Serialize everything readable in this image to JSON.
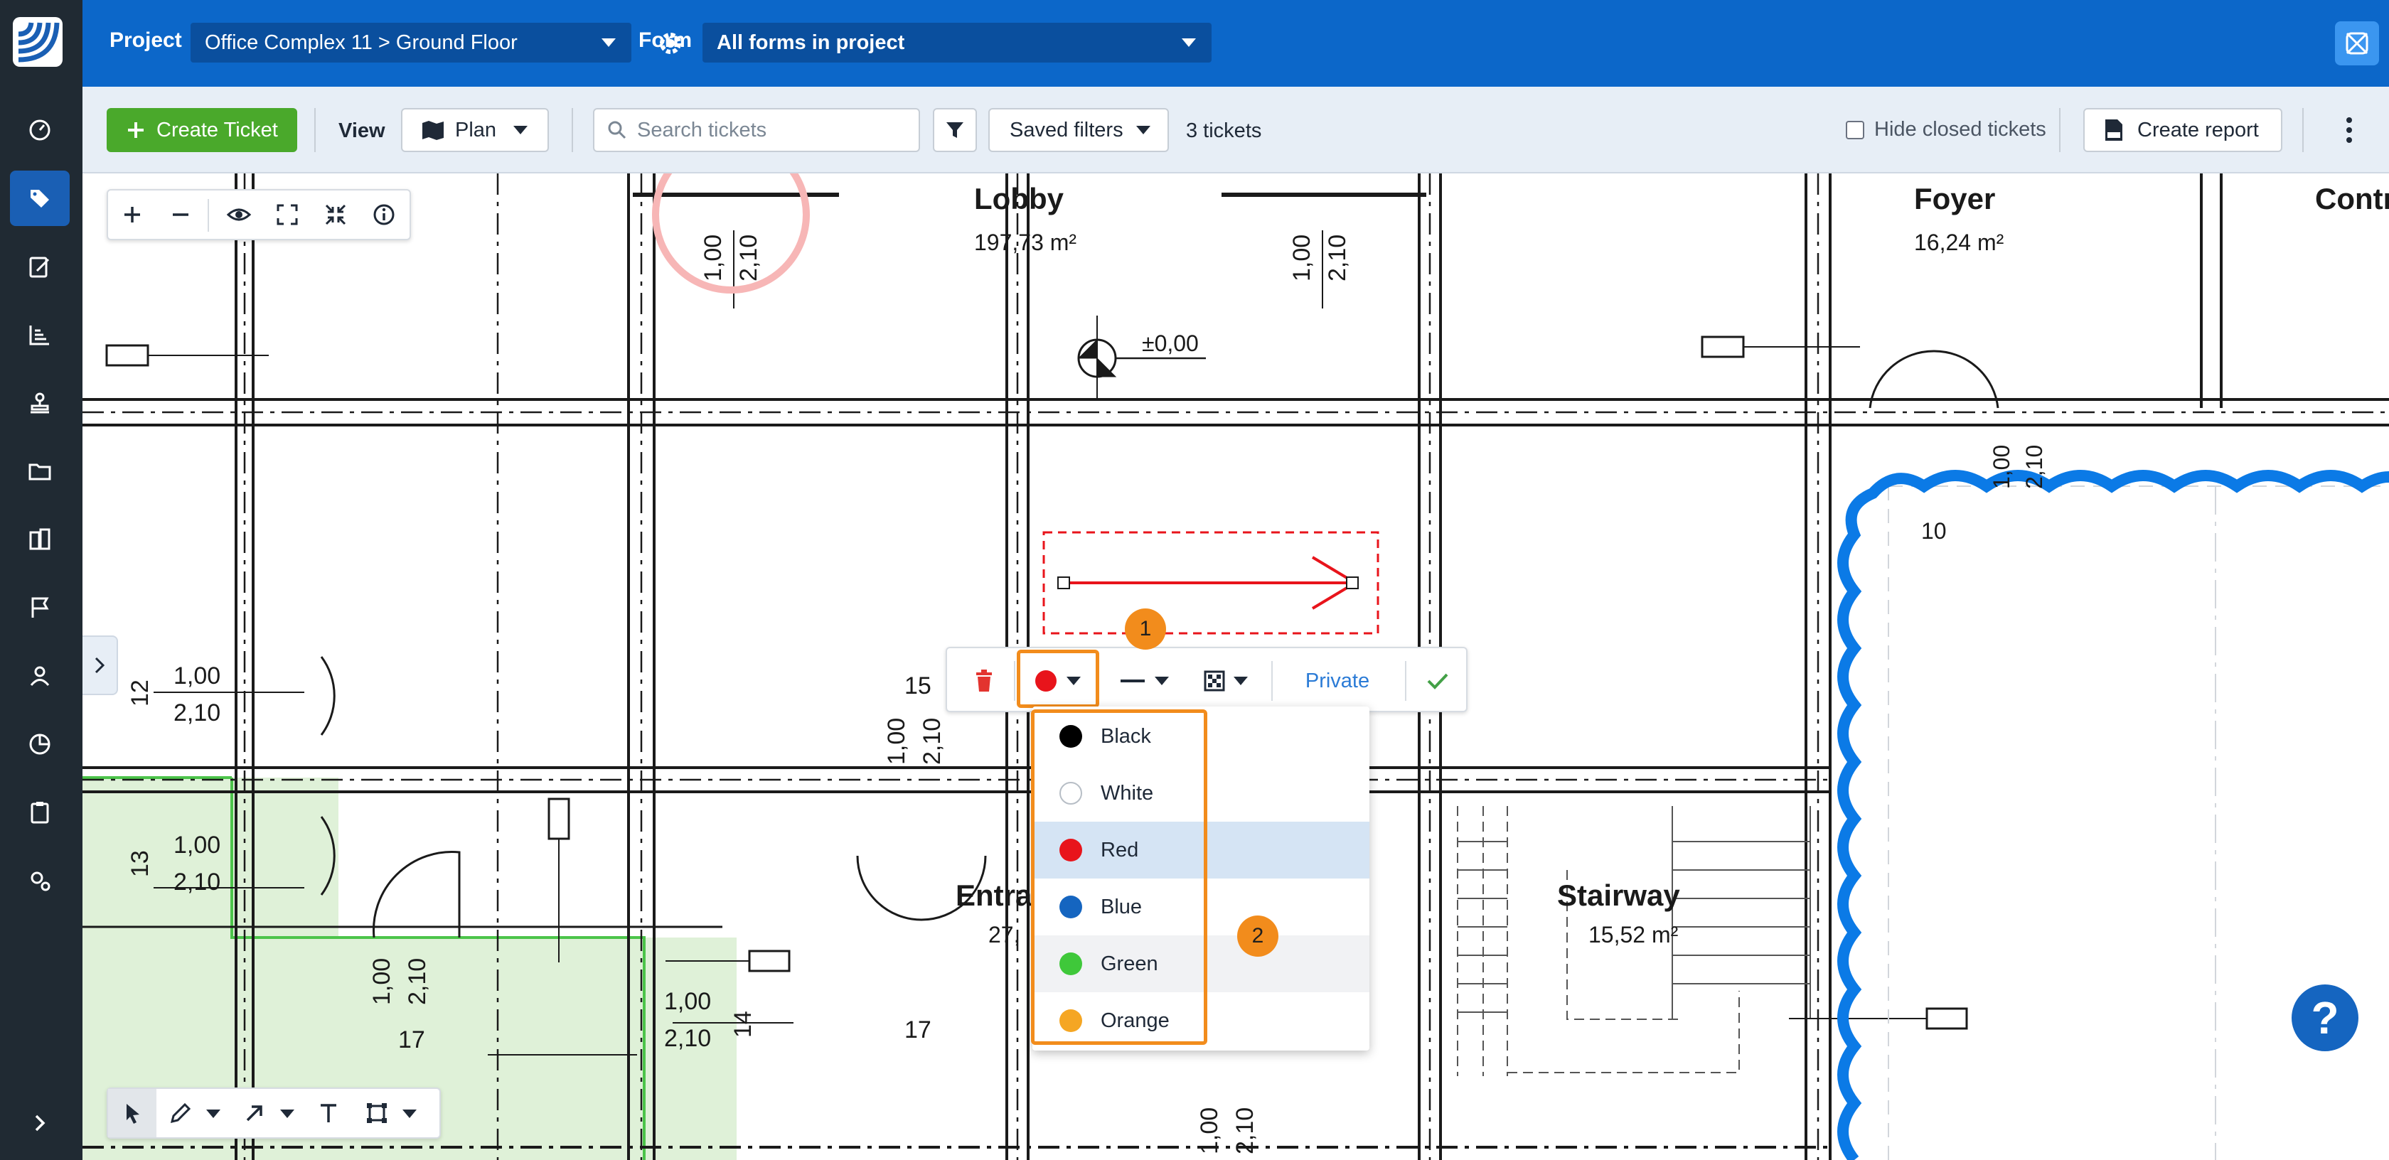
{
  "topbar": {
    "project_label": "Project",
    "project_value": "Office Complex 11 > Ground Floor",
    "form_label": "Form",
    "form_value": "All forms in project"
  },
  "toolbar": {
    "create_ticket": "Create Ticket",
    "view_label": "View",
    "view_value": "Plan",
    "search_placeholder": "Search tickets",
    "saved_filters": "Saved filters",
    "ticket_count": "3 tickets",
    "hide_closed": "Hide closed tickets",
    "create_report": "Create report"
  },
  "edit_bar": {
    "private_label": "Private"
  },
  "color_menu": {
    "items": [
      {
        "label": "Black",
        "color": "#000000"
      },
      {
        "label": "White",
        "color": "#ffffff"
      },
      {
        "label": "Red",
        "color": "#e8141b"
      },
      {
        "label": "Blue",
        "color": "#1565c0"
      },
      {
        "label": "Green",
        "color": "#3fc83a"
      },
      {
        "label": "Orange",
        "color": "#f5a623"
      }
    ],
    "selected": "Red"
  },
  "badges": {
    "one": "1",
    "two": "2"
  },
  "plan": {
    "rooms": [
      {
        "name": "Lobby",
        "area": "197,73 m²"
      },
      {
        "name": "Foyer",
        "area": "16,24 m²"
      },
      {
        "name": "Contr",
        "area": ""
      },
      {
        "name": "Stairway",
        "area": "15,52 m²"
      },
      {
        "name": "Entra",
        "area": "27,"
      }
    ],
    "level_mark": "±0,00",
    "labels": [
      "1,00",
      "2,10",
      "12",
      "13",
      "14",
      "15",
      "17",
      "10"
    ]
  },
  "help_label": "?",
  "colors": {
    "rail_bg": "#202a33",
    "topbar_bg": "#0c67c9",
    "accent_green": "#4aa92b",
    "highlight_orange": "#f28c1c",
    "cloud_blue": "#0b7ae6"
  }
}
